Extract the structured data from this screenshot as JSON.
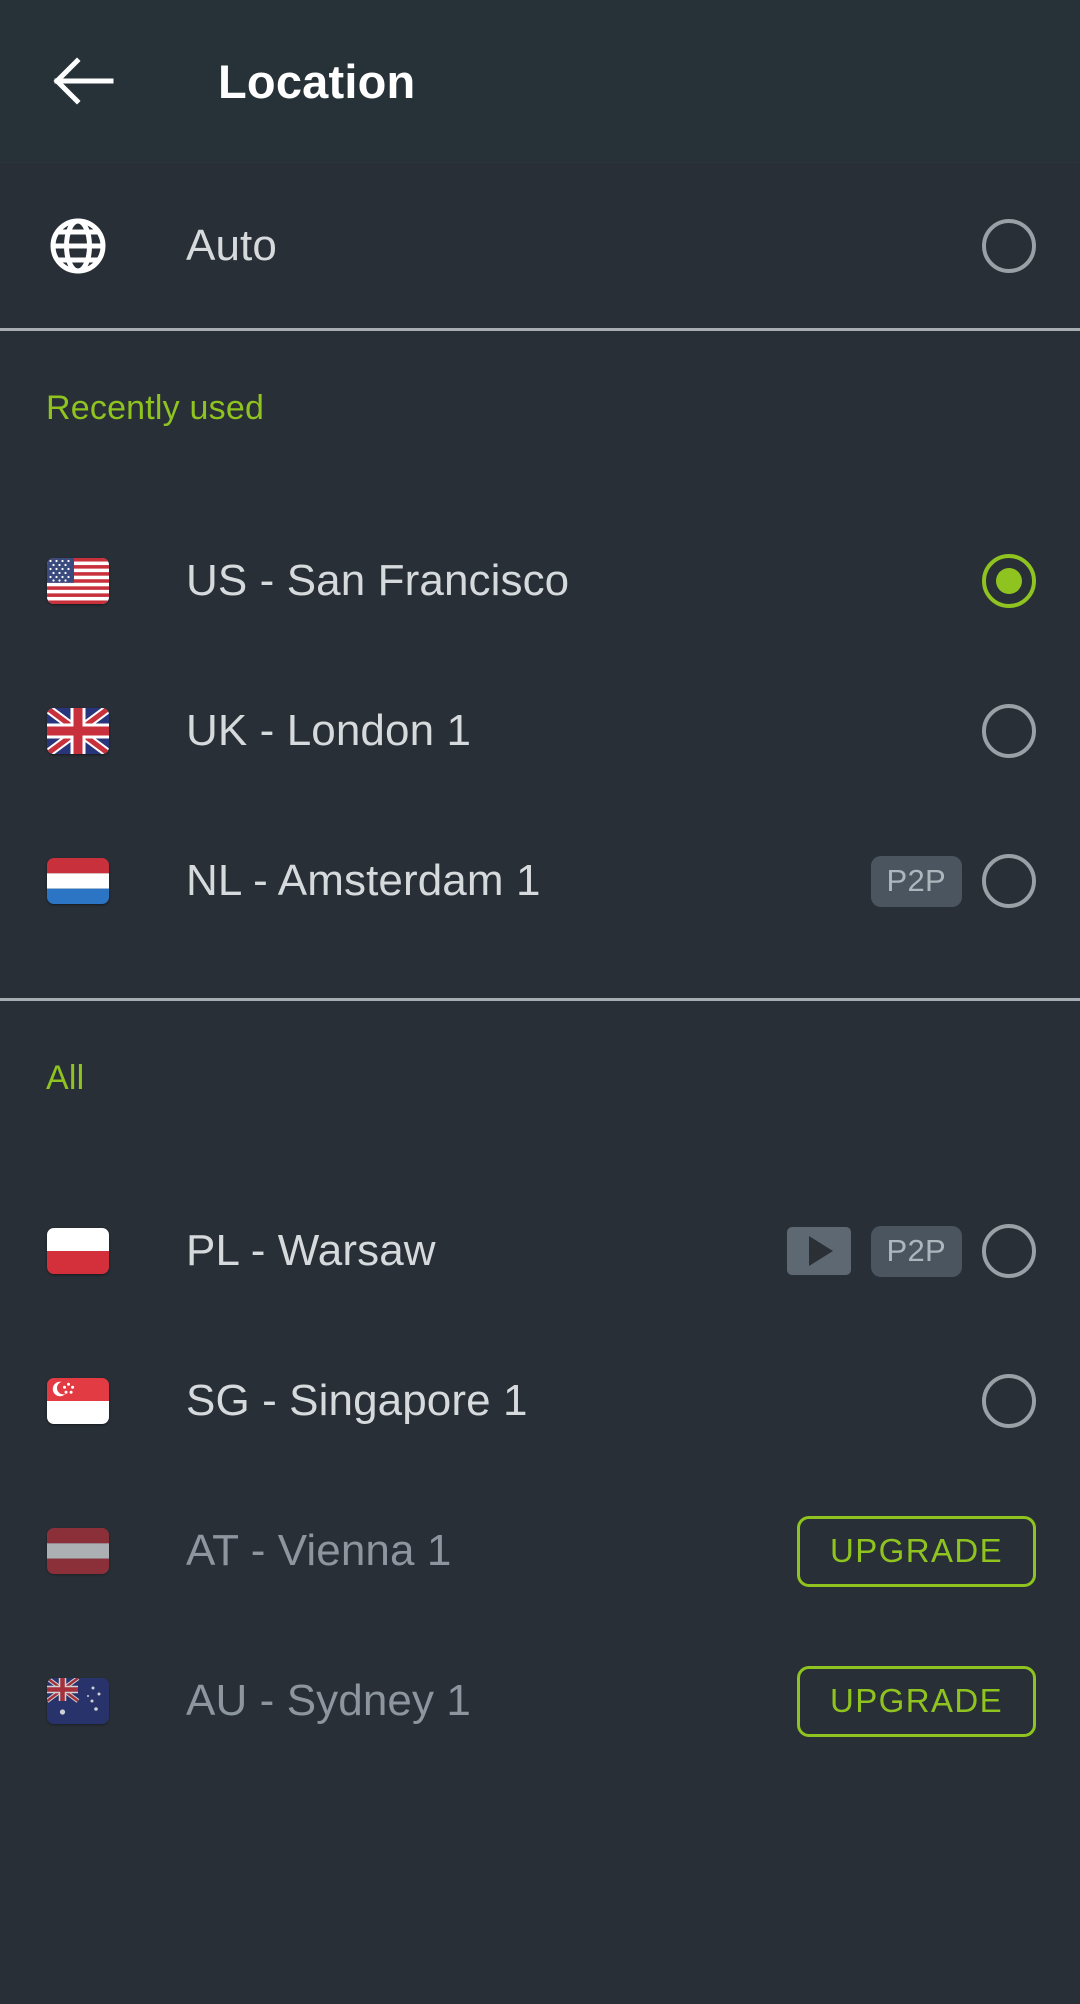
{
  "header": {
    "back_icon": "arrow-left-icon",
    "title": "Location"
  },
  "auto_row": {
    "icon": "globe-icon",
    "label": "Auto",
    "selected": false
  },
  "sections": [
    {
      "label": "Recently used",
      "items": [
        {
          "flag": "us-flag",
          "label": "US - San Francisco",
          "selected": true,
          "badges": []
        },
        {
          "flag": "uk-flag",
          "label": "UK - London 1",
          "selected": false,
          "badges": []
        },
        {
          "flag": "nl-flag",
          "label": "NL - Amsterdam 1",
          "selected": false,
          "badges": [
            "P2P"
          ]
        }
      ]
    },
    {
      "label": "All",
      "items": [
        {
          "flag": "pl-flag",
          "label": "PL - Warsaw",
          "selected": false,
          "badges": [
            "play",
            "P2P"
          ]
        },
        {
          "flag": "sg-flag",
          "label": "SG - Singapore 1",
          "selected": false,
          "badges": []
        },
        {
          "flag": "at-flag",
          "label": "AT - Vienna 1",
          "locked": true,
          "upgrade_label": "UPGRADE"
        },
        {
          "flag": "au-flag",
          "label": "AU - Sydney 1",
          "locked": true,
          "upgrade_label": "UPGRADE"
        }
      ]
    }
  ],
  "badge_labels": {
    "p2p": "P2P",
    "play": "streaming"
  },
  "colors": {
    "accent_green": "#8fc31f",
    "header_bg": "#263238",
    "body_bg": "#282f36",
    "text_primary": "#d7dadd",
    "text_dim": "#8d969e",
    "divider": "#a8adb1",
    "badge_bg": "#4b5560"
  }
}
